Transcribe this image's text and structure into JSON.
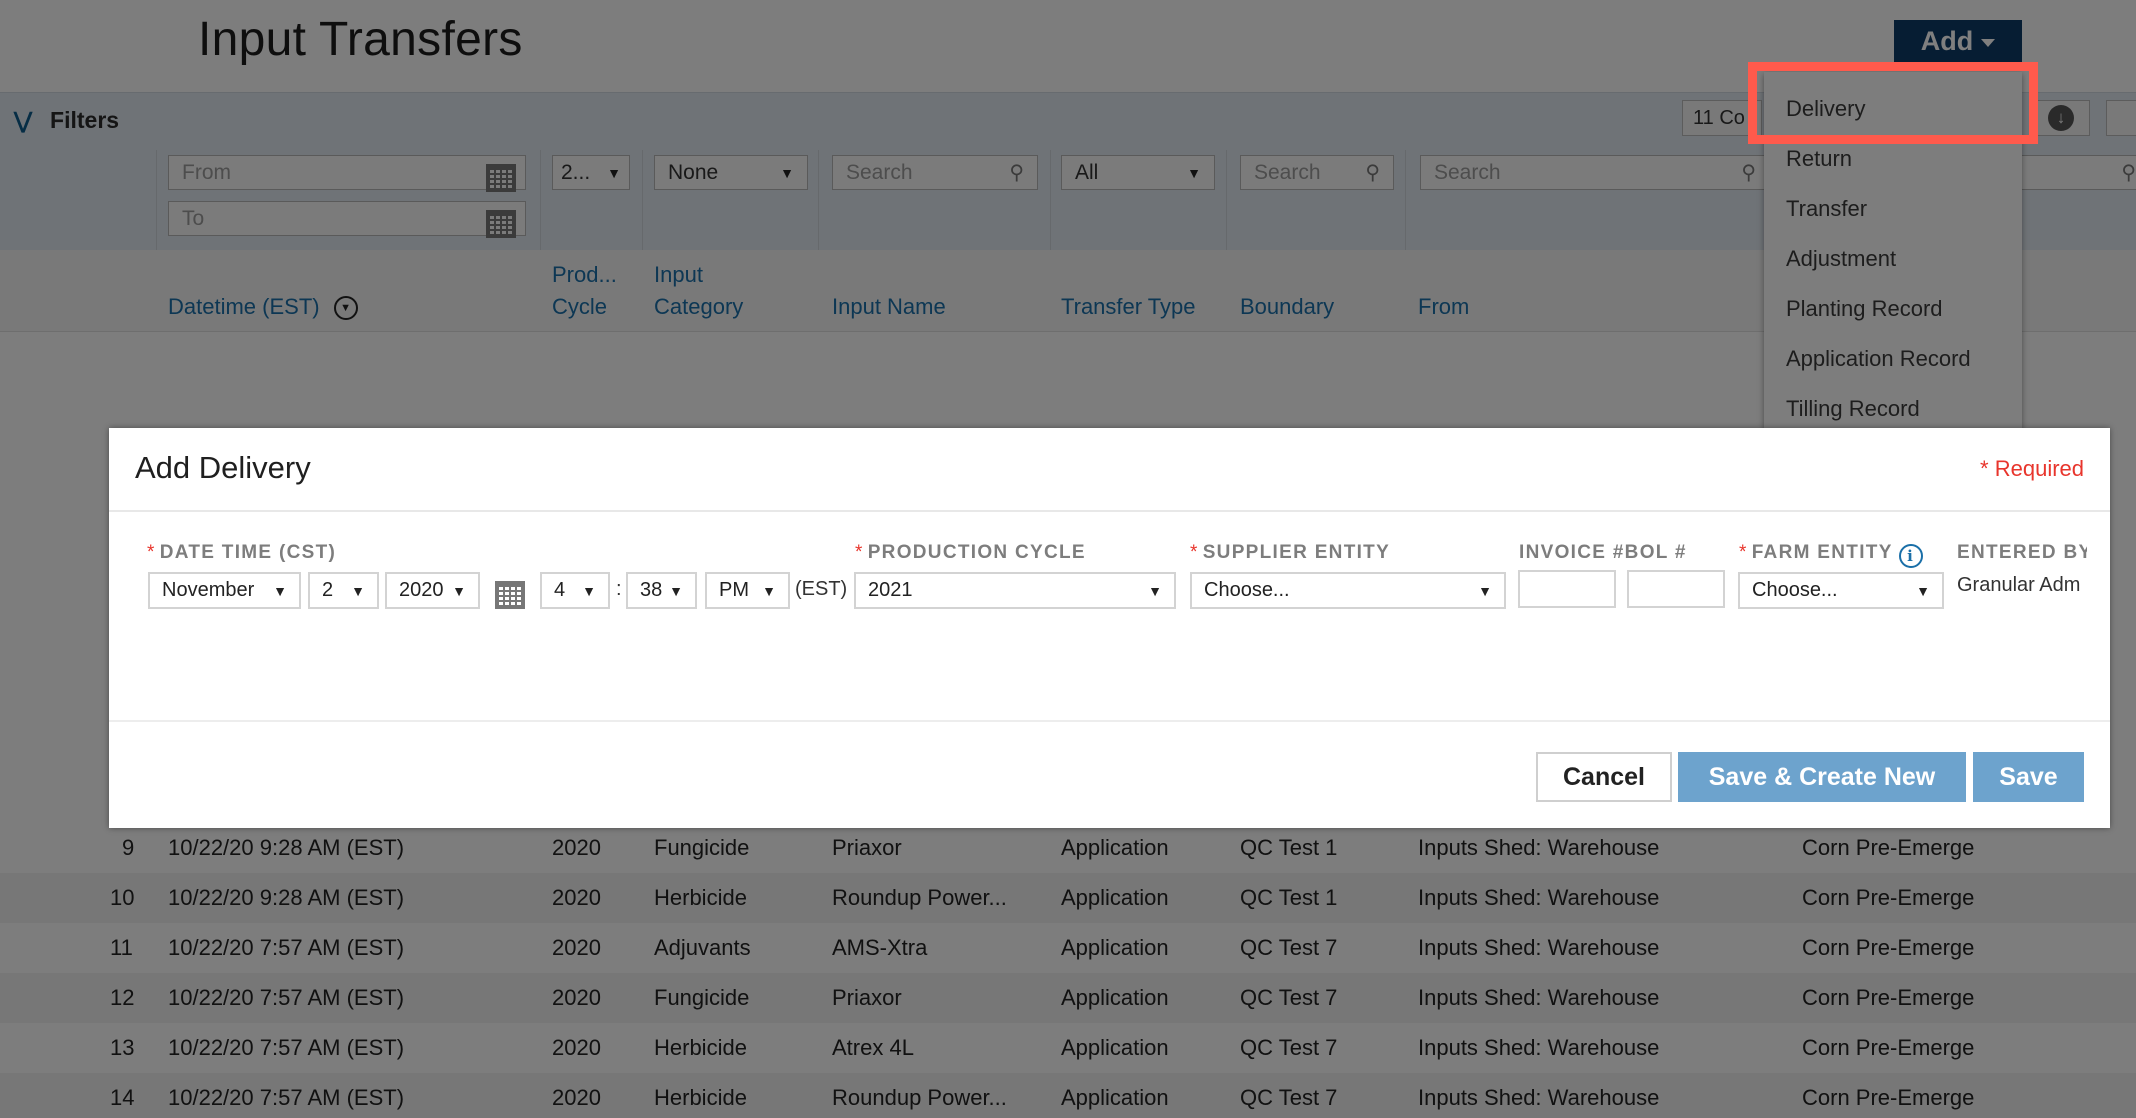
{
  "page": {
    "title": "Input Transfers",
    "add_button": "Add"
  },
  "filters": {
    "toggle_label": "Filters",
    "from_placeholder": "From",
    "to_placeholder": "To",
    "production_cycle": "2...",
    "input_category": "None",
    "input_name_placeholder": "Search",
    "transfer_type": "All",
    "boundary_placeholder": "Search",
    "from_search_placeholder": "Search",
    "columns_select": "11 Co"
  },
  "table": {
    "headers": {
      "datetime": "Datetime (EST)",
      "production_cycle_l1": "Prod...",
      "production_cycle_l2": "Cycle",
      "input_category_l1": "Input",
      "input_category_l2": "Category",
      "input_name": "Input Name",
      "transfer_type": "Transfer Type",
      "boundary": "Boundary",
      "from": "From"
    },
    "rows": [
      {
        "num": "9",
        "datetime": "10/22/20 9:28 AM (EST)",
        "cycle": "2020",
        "category": "Fungicide",
        "name": "Priaxor",
        "type": "Application",
        "boundary": "QC Test 1",
        "from": "Inputs Shed: Warehouse",
        "to": "Corn Pre-Emerge"
      },
      {
        "num": "10",
        "datetime": "10/22/20 9:28 AM (EST)",
        "cycle": "2020",
        "category": "Herbicide",
        "name": "Roundup Power...",
        "type": "Application",
        "boundary": "QC Test 1",
        "from": "Inputs Shed: Warehouse",
        "to": "Corn Pre-Emerge"
      },
      {
        "num": "11",
        "datetime": "10/22/20 7:57 AM (EST)",
        "cycle": "2020",
        "category": "Adjuvants",
        "name": "AMS-Xtra",
        "type": "Application",
        "boundary": "QC Test 7",
        "from": "Inputs Shed: Warehouse",
        "to": "Corn Pre-Emerge"
      },
      {
        "num": "12",
        "datetime": "10/22/20 7:57 AM (EST)",
        "cycle": "2020",
        "category": "Fungicide",
        "name": "Priaxor",
        "type": "Application",
        "boundary": "QC Test 7",
        "from": "Inputs Shed: Warehouse",
        "to": "Corn Pre-Emerge"
      },
      {
        "num": "13",
        "datetime": "10/22/20 7:57 AM (EST)",
        "cycle": "2020",
        "category": "Herbicide",
        "name": "Atrex 4L",
        "type": "Application",
        "boundary": "QC Test 7",
        "from": "Inputs Shed: Warehouse",
        "to": "Corn Pre-Emerge"
      },
      {
        "num": "14",
        "datetime": "10/22/20 7:57 AM (EST)",
        "cycle": "2020",
        "category": "Herbicide",
        "name": "Roundup Power...",
        "type": "Application",
        "boundary": "QC Test 7",
        "from": "Inputs Shed: Warehouse",
        "to": "Corn Pre-Emerge"
      }
    ]
  },
  "add_menu": {
    "items": [
      "Delivery",
      "Return",
      "Transfer",
      "Adjustment",
      "Planting Record",
      "Application Record",
      "Tilling Record"
    ],
    "highlighted": "Delivery",
    "highlight_color": "#ff5a4c"
  },
  "modal": {
    "title": "Add Delivery",
    "required_note": "* Required",
    "required_mark": "*",
    "fields": {
      "datetime_label": "DATE TIME (CST)",
      "month": "November",
      "day": "2",
      "year": "2020",
      "hour": "4",
      "time_sep": ":",
      "minute": "38",
      "ampm": "PM",
      "tz": "(EST)",
      "production_cycle_label": "PRODUCTION CYCLE",
      "production_cycle": "2021",
      "supplier_label": "SUPPLIER ENTITY",
      "supplier": "Choose...",
      "invoice_label": "INVOICE #BOL #",
      "invoice_value": "",
      "bol_value": "",
      "farm_label": "FARM ENTITY",
      "farm": "Choose...",
      "entered_by_label": "ENTERED BY",
      "entered_by": "Granular Adm"
    },
    "buttons": {
      "cancel": "Cancel",
      "save_create_new": "Save & Create New",
      "save": "Save"
    }
  },
  "colors": {
    "primary_dark": "#0c3a66",
    "primary_light": "#6da3cd",
    "link": "#1a6fa8",
    "required": "#e8352c"
  }
}
